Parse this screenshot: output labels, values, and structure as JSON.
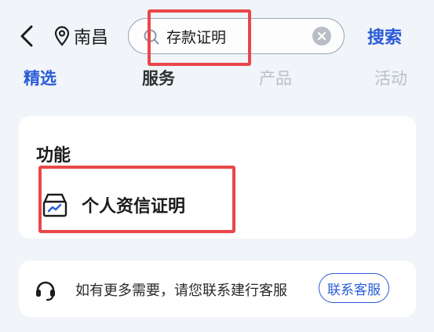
{
  "header": {
    "location": "南昌",
    "search": {
      "value": "存款证明",
      "placeholder": ""
    },
    "search_button": "搜索"
  },
  "tabs": [
    {
      "label": "精选",
      "state": "active"
    },
    {
      "label": "服务",
      "state": "normal"
    },
    {
      "label": "产品",
      "state": "dim"
    },
    {
      "label": "活动",
      "state": "dim"
    }
  ],
  "function_section": {
    "title": "功能",
    "items": [
      {
        "label": "个人资信证明",
        "icon": "document-box-icon"
      }
    ]
  },
  "help": {
    "text": "如有更多需要，请您联系建行客服",
    "button": "联系客服",
    "icon": "headset-icon"
  },
  "colors": {
    "accent": "#2a5bd7",
    "highlight": "#e9474a",
    "background": "#f1f4f9",
    "card": "#ffffff"
  }
}
